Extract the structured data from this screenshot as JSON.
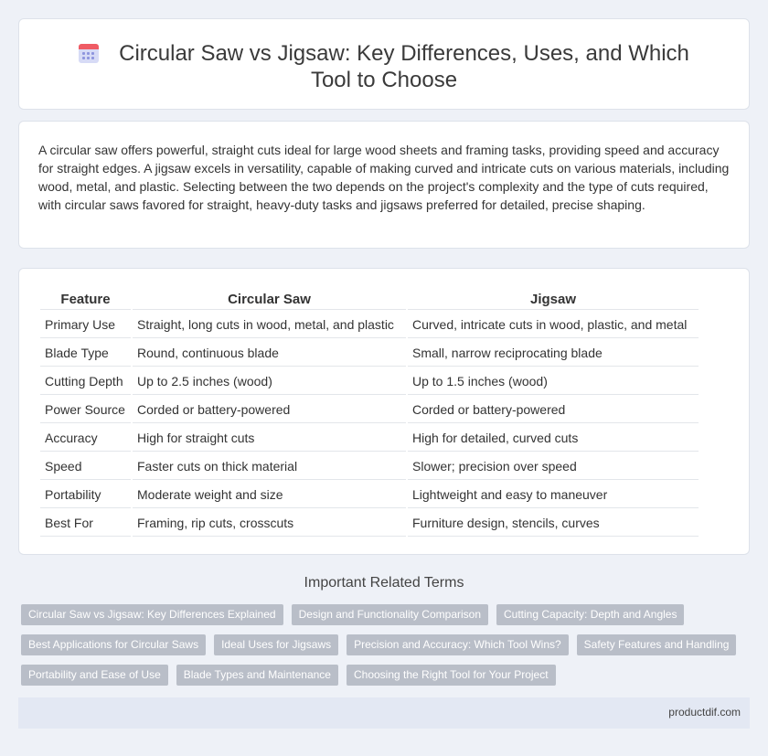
{
  "page": {
    "title": "Circular Saw vs Jigsaw: Key Differences, Uses, and Which Tool to Choose",
    "title_icon": "calendar-icon"
  },
  "intro": {
    "text": "A circular saw offers powerful, straight cuts ideal for large wood sheets and framing tasks, providing speed and accuracy for straight edges. A jigsaw excels in versatility, capable of making curved and intricate cuts on various materials, including wood, metal, and plastic. Selecting between the two depends on the project's complexity and the type of cuts required, with circular saws favored for straight, heavy-duty tasks and jigsaws preferred for detailed, precise shaping."
  },
  "table": {
    "headers": [
      "Feature",
      "Circular Saw",
      "Jigsaw"
    ],
    "rows": [
      [
        "Primary Use",
        "Straight, long cuts in wood, metal, and plastic",
        "Curved, intricate cuts in wood, plastic, and metal"
      ],
      [
        "Blade Type",
        "Round, continuous blade",
        "Small, narrow reciprocating blade"
      ],
      [
        "Cutting Depth",
        "Up to 2.5 inches (wood)",
        "Up to 1.5 inches (wood)"
      ],
      [
        "Power Source",
        "Corded or battery-powered",
        "Corded or battery-powered"
      ],
      [
        "Accuracy",
        "High for straight cuts",
        "High for detailed, curved cuts"
      ],
      [
        "Speed",
        "Faster cuts on thick material",
        "Slower; precision over speed"
      ],
      [
        "Portability",
        "Moderate weight and size",
        "Lightweight and easy to maneuver"
      ],
      [
        "Best For",
        "Framing, rip cuts, crosscuts",
        "Furniture design, stencils, curves"
      ]
    ]
  },
  "related": {
    "heading": "Important Related Terms",
    "rows": [
      [
        "Circular Saw vs Jigsaw: Key Differences Explained",
        "Design and Functionality Comparison",
        "Cutting Capacity: Depth and Angles"
      ],
      [
        "Best Applications for Circular Saws",
        "Ideal Uses for Jigsaws",
        "Precision and Accuracy: Which Tool Wins?",
        "Safety Features and Handling"
      ],
      [
        "Portability and Ease of Use",
        "Blade Types and Maintenance",
        "Choosing the Right Tool for Your Project"
      ]
    ]
  },
  "footer": {
    "site": "productdif.com"
  },
  "colors": {
    "background": "#eef1f7",
    "tag": "#b9bec8",
    "footer": "#e3e8f3"
  }
}
